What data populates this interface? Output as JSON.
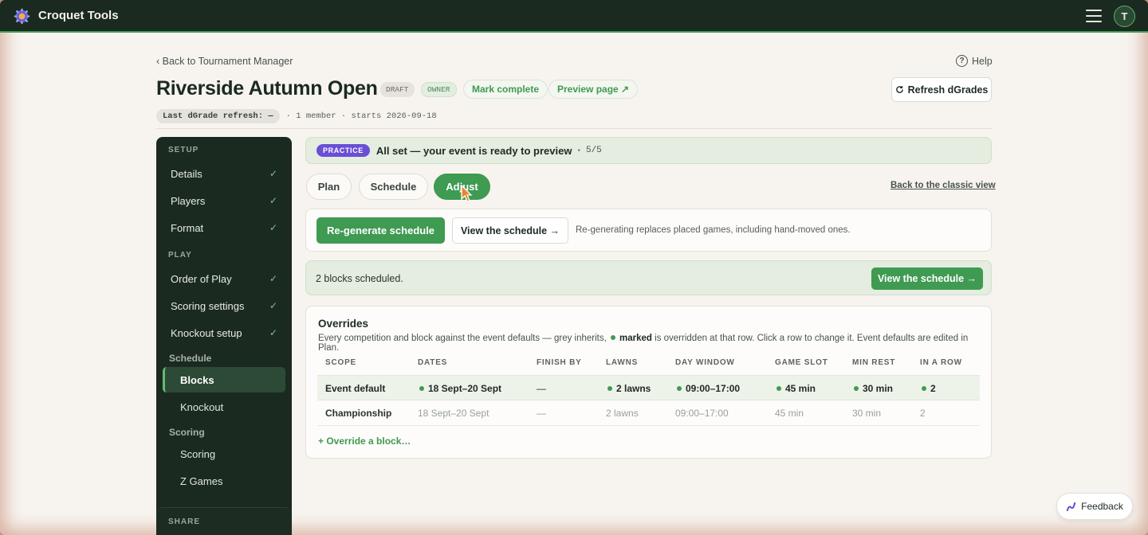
{
  "app": {
    "title": "Croquet Tools",
    "avatar_initial": "T"
  },
  "header": {
    "back_label": "‹ Back to Tournament Manager",
    "help_label": "Help",
    "title": "Riverside Autumn Open",
    "tags": {
      "draft": "DRAFT",
      "owner": "OWNER"
    },
    "mark_complete": "Mark complete",
    "preview_page": "Preview page ↗",
    "refresh": "Refresh dGrades",
    "meta_chip": "Last dGrade refresh: —",
    "meta_text": "· 1 member · starts 2026-09-18"
  },
  "sidebar": {
    "setup_label": "SETUP",
    "setup_items": [
      {
        "label": "Details",
        "check": "✓"
      },
      {
        "label": "Players",
        "check": "✓"
      },
      {
        "label": "Format",
        "check": "✓"
      }
    ],
    "play_label": "PLAY",
    "play_items": [
      {
        "label": "Order of Play",
        "check": "✓"
      },
      {
        "label": "Scoring settings",
        "check": "✓"
      },
      {
        "label": "Knockout setup",
        "check": "✓"
      }
    ],
    "schedule_group": "Schedule",
    "schedule_items": [
      "Blocks",
      "Knockout"
    ],
    "scoring_group": "Scoring",
    "scoring_items": [
      "Scoring",
      "Z Games"
    ],
    "share_label": "SHARE"
  },
  "banner": {
    "badge": "PRACTICE",
    "text": "All set — your event is ready to preview",
    "dot": "•",
    "count": "5/5"
  },
  "tabs": {
    "plan": "Plan",
    "schedule": "Schedule",
    "adjust": "Adjust",
    "classic_link": "Back to the classic view"
  },
  "regen": {
    "button": "Re-generate schedule",
    "view": "View the schedule →",
    "note": "Re-generating replaces placed games, including hand-moved ones."
  },
  "scheduled": {
    "text": "2 blocks scheduled.",
    "button": "View the schedule →"
  },
  "overrides": {
    "title": "Overrides",
    "desc_before": "Every competition and block against the event defaults — grey inherits,",
    "desc_marked": "marked",
    "desc_after": "is overridden at that row. Click a row to change it. Event defaults are edited in Plan.",
    "columns": [
      "SCOPE",
      "DATES",
      "FINISH BY",
      "LAWNS",
      "DAY WINDOW",
      "GAME SLOT",
      "MIN REST",
      "IN A ROW"
    ],
    "rows": [
      {
        "scope": "Event default",
        "dates": "18 Sept–20 Sept",
        "finish_by": "—",
        "lawns": "2 lawns",
        "day_window": "09:00–17:00",
        "game_slot": "45 min",
        "min_rest": "30 min",
        "in_a_row": "2"
      },
      {
        "scope": "Championship",
        "dates": "18 Sept–20 Sept",
        "finish_by": "—",
        "lawns": "2 lawns",
        "day_window": "09:00–17:00",
        "game_slot": "45 min",
        "min_rest": "30 min",
        "in_a_row": "2"
      }
    ],
    "add_link": "+ Override a block…"
  },
  "feedback": {
    "label": "Feedback"
  },
  "colors": {
    "accent": "#3f9a52",
    "topbar": "#1b2a20",
    "practice": "#6a4fd6"
  }
}
